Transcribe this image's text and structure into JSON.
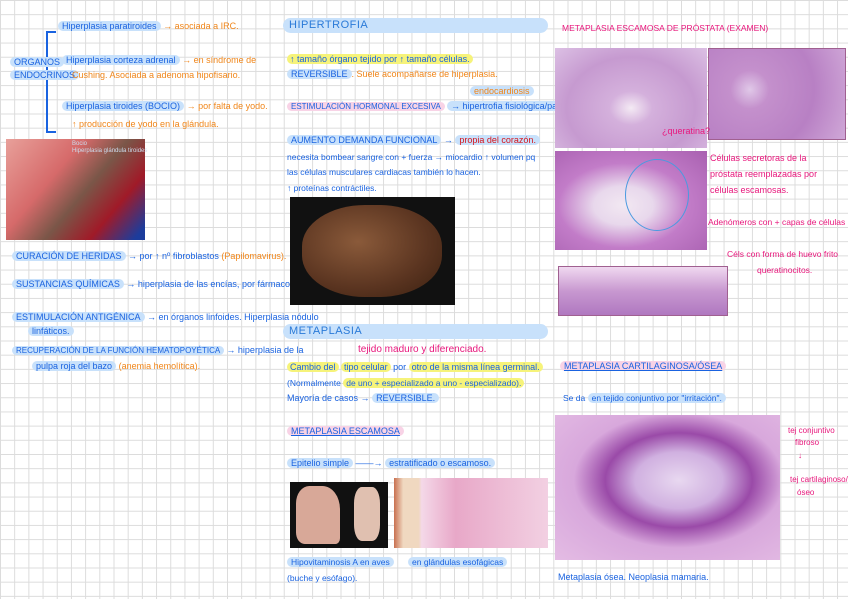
{
  "left": {
    "organos": [
      "ORGANOS",
      "ENDOCRINOS"
    ],
    "items": [
      {
        "label": "Hiperplasia paratiroides",
        "note": "→ asociada a IRC."
      },
      {
        "label": "Hiperplasia corteza adrenal",
        "note": "→ en síndrome de",
        "note2": "Cushing. Asociada a adenoma hipofisario."
      },
      {
        "label": "Hiperplasia tiroides (BOCIO)",
        "note": "→ por falta de yodo.",
        "note2": "↑ producción de yodo en la glándula."
      }
    ],
    "photo_caption": [
      "Bocio",
      "Hiperplasia glándula tiroides"
    ],
    "curacion": {
      "label": "CURACIÓN DE HERIDAS",
      "text": "→ por ↑ nº fibroblastos",
      "note": "(Papilomavirus)."
    },
    "sustancias": {
      "label": "SUSTANCIAS QUÍMICAS",
      "text": "→ hiperplasia de las encías, por fármacos."
    },
    "estimulacion": {
      "label": "ESTIMULACIÓN ANTIGÉNICA",
      "text": "→ en órganos linfoides. Hiperplasia nódulo",
      "text2": "linfáticos."
    },
    "recuperacion": {
      "label": "RECUPERACIÓN DE LA FUNCIÓN HEMATOPOYÉTICA",
      "text": "→ hiperplasia de la",
      "text2": "pulpa roja del bazo",
      "note": "(anemia hemolítica)."
    }
  },
  "middle": {
    "hipertrofia_title": "HIPERTROFIA",
    "h1": "↑ tamaño órgano tejido por ↑ tamaño células.",
    "reversible": "REVERSIBLE",
    "reversible_note": ". Suele acompañarse de hiperplasia.",
    "endocardiosis": "endocardiosis",
    "estim_label": "ESTIMULACIÓN HORMONAL EXCESIVA",
    "estim_text": "→ hipertrofia fisiológica/patológica.",
    "aumento_label": "AUMENTO DEMANDA FUNCIONAL",
    "aumento_arrow": "→",
    "aumento_text": "propia del corazón.",
    "l1": "necesita bombear sangre con + fuerza → miocardio ↑ volumen pq",
    "l2": "las células musculares cardiacas también lo hacen.",
    "l3": "↑ proteínas contráctiles.",
    "metaplasia_title": "METAPLASIA",
    "tejido": "tejido maduro y diferenciado.",
    "cambio_a": "Cambio del",
    "cambio_b": "tipo celular",
    "cambio_c": "por",
    "cambio_d": "otro de la misma línea germinal.",
    "normal_a": "(Normalmente",
    "normal_b": "de uno + especializado a uno - especializado).",
    "mayoria": "Mayoría de casos →",
    "mayoria_rev": "REVERSIBLE.",
    "escamosa_title": "METAPLASIA ESCAMOSA",
    "epitelio_a": "Epitelio simple",
    "epitelio_arrow": "——→",
    "epitelio_b": "estratificado o escamoso.",
    "cap1": "Hipovitaminosis A en aves",
    "cap1b": "(buche y esófago).",
    "cap2": "en glándulas esofágicas"
  },
  "right": {
    "prostata_title": "METAPLASIA ESCAMOSA DE PRÓSTATA (EXAMEN)",
    "queratina": "¿queratina?",
    "p1": [
      "Células secretoras de la",
      "próstata reemplazadas por",
      "células escamosas."
    ],
    "p2": "Adenómeros con + capas de células",
    "p3": [
      "Céls con forma de huevo frito",
      "queratinocitos."
    ],
    "cart_title": "METAPLASIA CARTILAGINOSA/ÓSEA",
    "se_da_a": "Se da",
    "se_da_b": "en tejido conjuntivo por \"irritación\".",
    "side": [
      "tej conjuntivo",
      "fibroso",
      "↓",
      "tej cartilaginoso/",
      "óseo"
    ],
    "caption": "Metaplasia ósea. Neoplasia mamaria."
  }
}
